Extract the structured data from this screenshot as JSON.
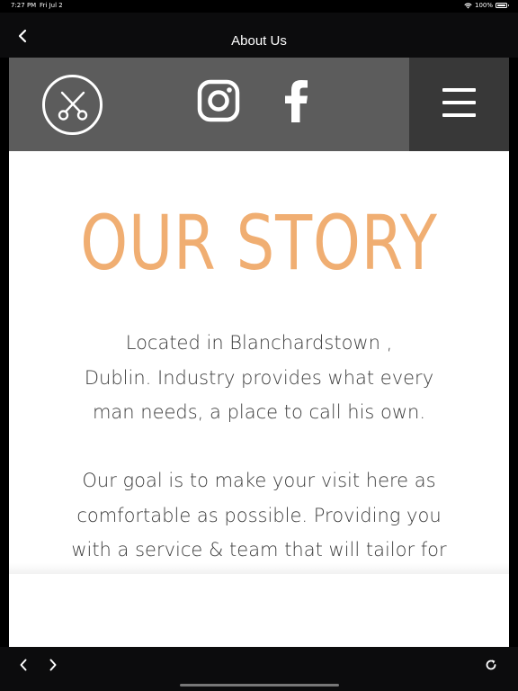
{
  "status_bar": {
    "time": "7:27 PM",
    "date": "Fri Jul 2",
    "battery": "100%",
    "icons": [
      "wifi-icon",
      "battery-icon"
    ]
  },
  "nav": {
    "title": "About Us",
    "back_icon": "chevron-left-icon"
  },
  "site": {
    "header": {
      "background": "#5c5c5c",
      "menu_background": "#383838",
      "logo_icon": "scissors-icon",
      "social_icons": [
        "instagram-icon",
        "facebook-icon"
      ],
      "menu_icon": "hamburger-menu-icon"
    },
    "heading": "OUR STORY",
    "heading_color": "#f0ae72",
    "paragraph_1_lines": [
      "Located in Blanchardstown ,",
      "Dublin. Industry provides what every",
      "man needs, a place to call his own."
    ],
    "paragraph_2_lines": [
      "Our goal is to make your visit here as",
      "comfortable as possible. Providing you",
      "with a service & team that will tailor for"
    ]
  },
  "toolbar": {
    "icons": [
      "chevron-left-icon",
      "chevron-right-icon",
      "reload-icon"
    ]
  }
}
